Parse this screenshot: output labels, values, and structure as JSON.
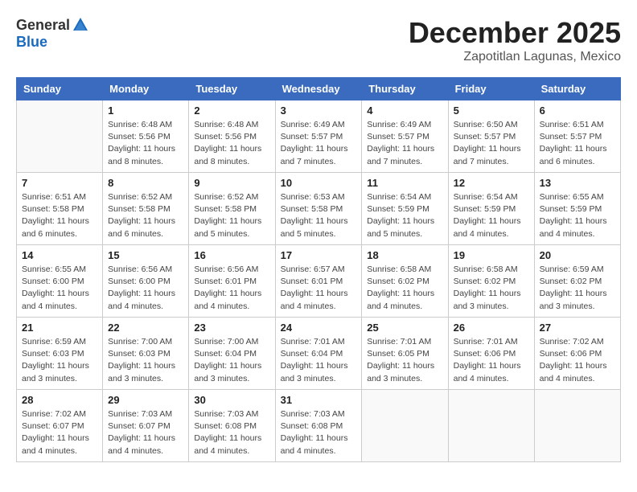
{
  "logo": {
    "general": "General",
    "blue": "Blue"
  },
  "title": "December 2025",
  "location": "Zapotitlan Lagunas, Mexico",
  "days_of_week": [
    "Sunday",
    "Monday",
    "Tuesday",
    "Wednesday",
    "Thursday",
    "Friday",
    "Saturday"
  ],
  "weeks": [
    [
      {
        "day": "",
        "info": ""
      },
      {
        "day": "1",
        "info": "Sunrise: 6:48 AM\nSunset: 5:56 PM\nDaylight: 11 hours\nand 8 minutes."
      },
      {
        "day": "2",
        "info": "Sunrise: 6:48 AM\nSunset: 5:56 PM\nDaylight: 11 hours\nand 8 minutes."
      },
      {
        "day": "3",
        "info": "Sunrise: 6:49 AM\nSunset: 5:57 PM\nDaylight: 11 hours\nand 7 minutes."
      },
      {
        "day": "4",
        "info": "Sunrise: 6:49 AM\nSunset: 5:57 PM\nDaylight: 11 hours\nand 7 minutes."
      },
      {
        "day": "5",
        "info": "Sunrise: 6:50 AM\nSunset: 5:57 PM\nDaylight: 11 hours\nand 7 minutes."
      },
      {
        "day": "6",
        "info": "Sunrise: 6:51 AM\nSunset: 5:57 PM\nDaylight: 11 hours\nand 6 minutes."
      }
    ],
    [
      {
        "day": "7",
        "info": "Sunrise: 6:51 AM\nSunset: 5:58 PM\nDaylight: 11 hours\nand 6 minutes."
      },
      {
        "day": "8",
        "info": "Sunrise: 6:52 AM\nSunset: 5:58 PM\nDaylight: 11 hours\nand 6 minutes."
      },
      {
        "day": "9",
        "info": "Sunrise: 6:52 AM\nSunset: 5:58 PM\nDaylight: 11 hours\nand 5 minutes."
      },
      {
        "day": "10",
        "info": "Sunrise: 6:53 AM\nSunset: 5:58 PM\nDaylight: 11 hours\nand 5 minutes."
      },
      {
        "day": "11",
        "info": "Sunrise: 6:54 AM\nSunset: 5:59 PM\nDaylight: 11 hours\nand 5 minutes."
      },
      {
        "day": "12",
        "info": "Sunrise: 6:54 AM\nSunset: 5:59 PM\nDaylight: 11 hours\nand 4 minutes."
      },
      {
        "day": "13",
        "info": "Sunrise: 6:55 AM\nSunset: 5:59 PM\nDaylight: 11 hours\nand 4 minutes."
      }
    ],
    [
      {
        "day": "14",
        "info": "Sunrise: 6:55 AM\nSunset: 6:00 PM\nDaylight: 11 hours\nand 4 minutes."
      },
      {
        "day": "15",
        "info": "Sunrise: 6:56 AM\nSunset: 6:00 PM\nDaylight: 11 hours\nand 4 minutes."
      },
      {
        "day": "16",
        "info": "Sunrise: 6:56 AM\nSunset: 6:01 PM\nDaylight: 11 hours\nand 4 minutes."
      },
      {
        "day": "17",
        "info": "Sunrise: 6:57 AM\nSunset: 6:01 PM\nDaylight: 11 hours\nand 4 minutes."
      },
      {
        "day": "18",
        "info": "Sunrise: 6:58 AM\nSunset: 6:02 PM\nDaylight: 11 hours\nand 4 minutes."
      },
      {
        "day": "19",
        "info": "Sunrise: 6:58 AM\nSunset: 6:02 PM\nDaylight: 11 hours\nand 3 minutes."
      },
      {
        "day": "20",
        "info": "Sunrise: 6:59 AM\nSunset: 6:02 PM\nDaylight: 11 hours\nand 3 minutes."
      }
    ],
    [
      {
        "day": "21",
        "info": "Sunrise: 6:59 AM\nSunset: 6:03 PM\nDaylight: 11 hours\nand 3 minutes."
      },
      {
        "day": "22",
        "info": "Sunrise: 7:00 AM\nSunset: 6:03 PM\nDaylight: 11 hours\nand 3 minutes."
      },
      {
        "day": "23",
        "info": "Sunrise: 7:00 AM\nSunset: 6:04 PM\nDaylight: 11 hours\nand 3 minutes."
      },
      {
        "day": "24",
        "info": "Sunrise: 7:01 AM\nSunset: 6:04 PM\nDaylight: 11 hours\nand 3 minutes."
      },
      {
        "day": "25",
        "info": "Sunrise: 7:01 AM\nSunset: 6:05 PM\nDaylight: 11 hours\nand 3 minutes."
      },
      {
        "day": "26",
        "info": "Sunrise: 7:01 AM\nSunset: 6:06 PM\nDaylight: 11 hours\nand 4 minutes."
      },
      {
        "day": "27",
        "info": "Sunrise: 7:02 AM\nSunset: 6:06 PM\nDaylight: 11 hours\nand 4 minutes."
      }
    ],
    [
      {
        "day": "28",
        "info": "Sunrise: 7:02 AM\nSunset: 6:07 PM\nDaylight: 11 hours\nand 4 minutes."
      },
      {
        "day": "29",
        "info": "Sunrise: 7:03 AM\nSunset: 6:07 PM\nDaylight: 11 hours\nand 4 minutes."
      },
      {
        "day": "30",
        "info": "Sunrise: 7:03 AM\nSunset: 6:08 PM\nDaylight: 11 hours\nand 4 minutes."
      },
      {
        "day": "31",
        "info": "Sunrise: 7:03 AM\nSunset: 6:08 PM\nDaylight: 11 hours\nand 4 minutes."
      },
      {
        "day": "",
        "info": ""
      },
      {
        "day": "",
        "info": ""
      },
      {
        "day": "",
        "info": ""
      }
    ]
  ]
}
